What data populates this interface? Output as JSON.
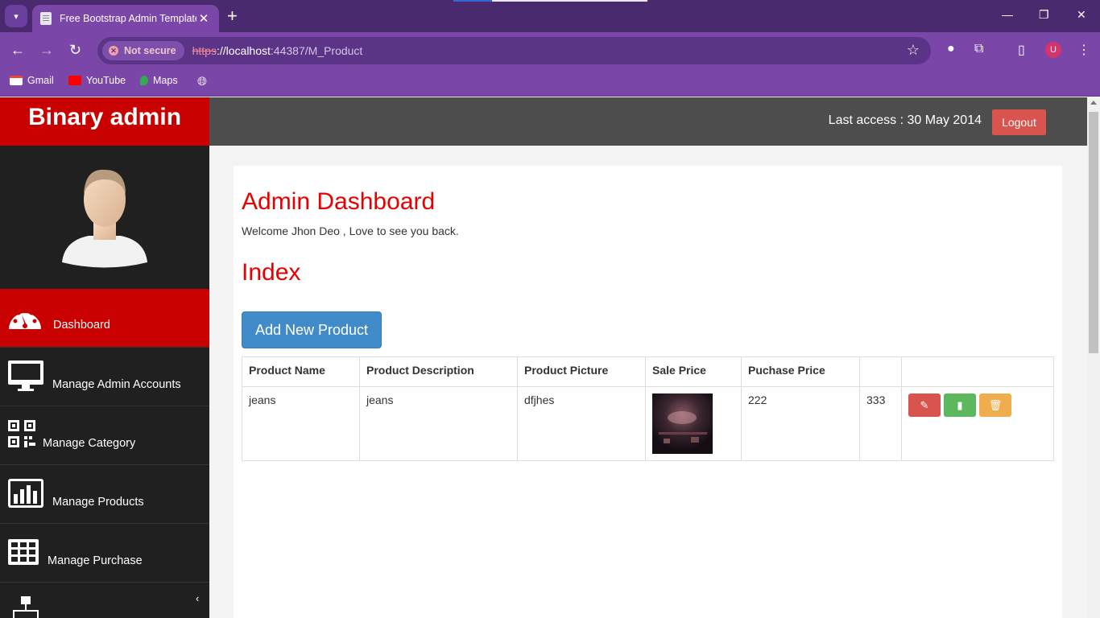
{
  "browser": {
    "tab_title": "Free Bootstrap Admin Template",
    "security_label": "Not secure",
    "url_scheme": "https",
    "url_host": "://localhost",
    "url_path": ":44387/M_Product",
    "profile_initial": "U",
    "bookmarks": [
      {
        "label": "Gmail"
      },
      {
        "label": "YouTube"
      },
      {
        "label": "Maps"
      }
    ]
  },
  "app": {
    "brand": "Binary admin",
    "last_access": "Last access : 30 May 2014",
    "logout_label": "Logout"
  },
  "sidebar": {
    "items": [
      {
        "label": "Dashboard",
        "icon": "dashboard-icon",
        "active": true
      },
      {
        "label": "Manage Admin Accounts",
        "icon": "desktop-icon"
      },
      {
        "label": "Manage Category",
        "icon": "qrcode-icon"
      },
      {
        "label": "Manage Products",
        "icon": "bar-chart-icon"
      },
      {
        "label": "Manage Purchase",
        "icon": "table-icon"
      },
      {
        "label": "",
        "icon": "sitemap-icon"
      }
    ]
  },
  "main": {
    "heading": "Admin Dashboard",
    "welcome": "Welcome Jhon Deo , Love to see you back.",
    "subheading": "Index",
    "add_button": "Add New Product",
    "table": {
      "headers": [
        "Product Name",
        "Product Description",
        "Product Picture",
        "Sale Price",
        "Puchase Price",
        "",
        ""
      ],
      "rows": [
        {
          "name": "jeans",
          "description": "jeans",
          "picture": "dfjhes",
          "sale_price": "222",
          "purchase_price": "333"
        }
      ]
    }
  },
  "colors": {
    "brand_red": "#c90000",
    "heading_red": "#e80000",
    "primary_blue": "#428bca",
    "danger": "#d9534f",
    "success": "#5cb85c",
    "warning": "#f0ad4e"
  }
}
